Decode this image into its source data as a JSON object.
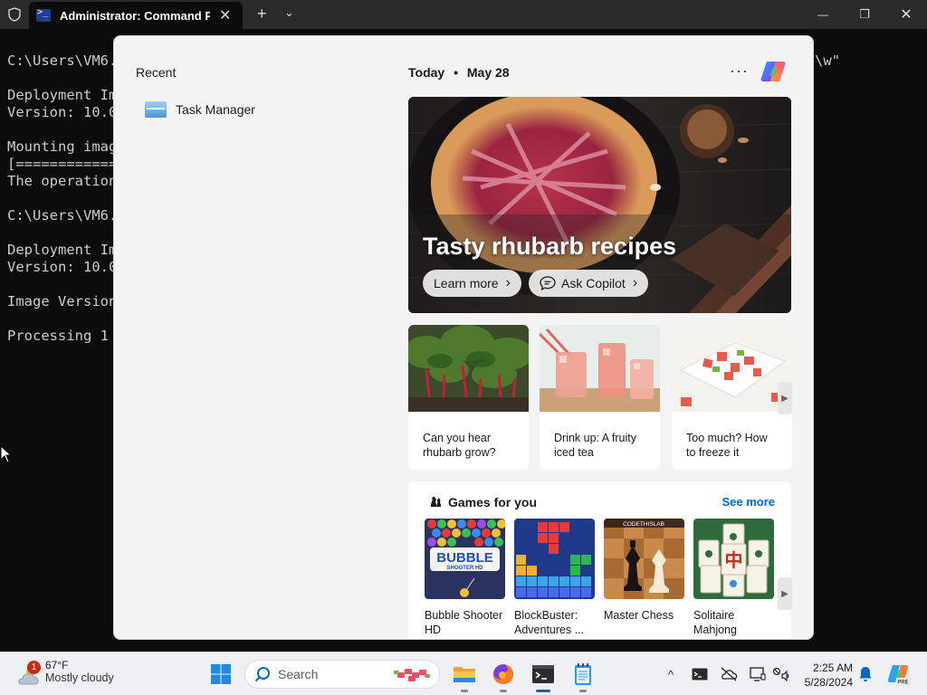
{
  "window": {
    "tab_title": "Administrator:  Command Prc",
    "close_glyph": "✕",
    "new_tab_glyph": "+",
    "dropdown_glyph": "⌄",
    "minimize_glyph": "—",
    "restore_glyph": "❐",
    "window_close_glyph": "✕"
  },
  "terminal": {
    "lines": "C:\\Users\\VM6.\n\nDeployment Im\nVersion: 10.0\n\nMounting imag\n[============\nThe operation\n\nC:\\Users\\VM6.\n\nDeployment Im\nVersion: 10.0\n\nImage Version\n\nProcessing 1",
    "right_fragment": "\\w\""
  },
  "flyout": {
    "recent_heading": "Recent",
    "recent_items": [
      {
        "label": "Task Manager",
        "icon": "task-manager-icon"
      }
    ],
    "today_label": "Today",
    "separator": "•",
    "date": "May 28",
    "more_glyph": "···",
    "hero": {
      "title": "Tasty rhubarb recipes",
      "learn_more": "Learn more",
      "ask_copilot": "Ask Copilot",
      "chevron": "›"
    },
    "cards": [
      {
        "title": "Can you hear rhubarb grow?"
      },
      {
        "title": "Drink up: A fruity iced tea"
      },
      {
        "title": "Too much? How to freeze it"
      }
    ],
    "games": {
      "heading": "Games for you",
      "see_more": "See more",
      "items": [
        {
          "title": "Bubble Shooter HD",
          "art_text_1": "BUBBLE",
          "art_text_2": "SHOOTER HD"
        },
        {
          "title": "BlockBuster: Adventures ..."
        },
        {
          "title": "Master Chess",
          "art_text_1": "CODETHISLAB"
        },
        {
          "title": "Solitaire Mahjong Classic",
          "art_text_1": "中"
        }
      ]
    }
  },
  "taskbar": {
    "weather_temp": "67°F",
    "weather_condition": "Mostly cloudy",
    "weather_badge": "1",
    "search_placeholder": "Search",
    "time": "2:25 AM",
    "date": "5/28/2024",
    "tray_expand_glyph": "^"
  },
  "colors": {
    "accent": "#0067c0",
    "terminal_bg": "#0c0c0c",
    "panel_bg": "#f3f3f3"
  }
}
